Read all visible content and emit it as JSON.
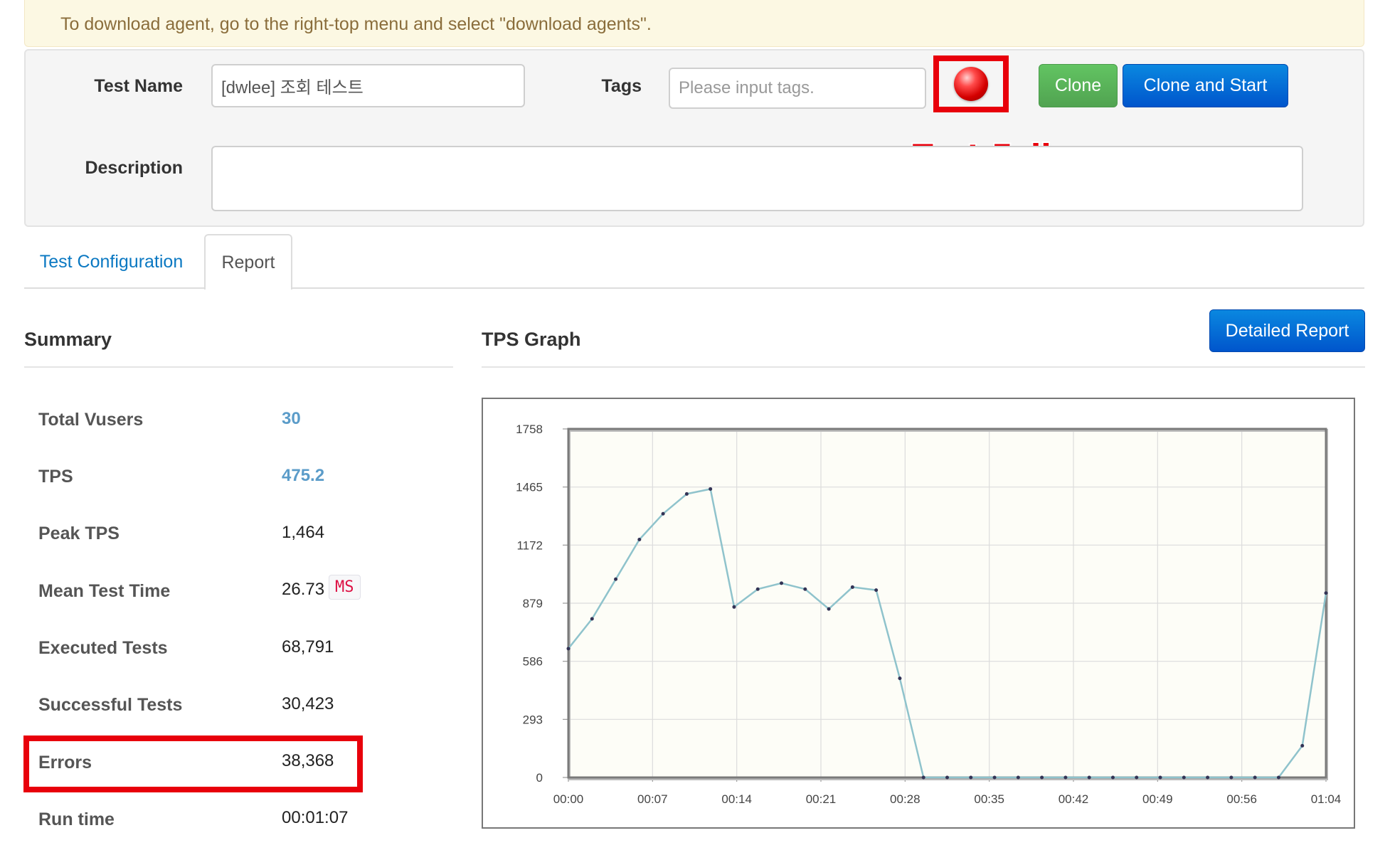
{
  "notice": {
    "text": "To download agent, go to the right-top menu and select \"download agents\"."
  },
  "form": {
    "test_name_label": "Test Name",
    "test_name_value": "[dwlee] 조회 테스트",
    "tags_label": "Tags",
    "tags_placeholder": "Please input tags.",
    "status": "failed",
    "status_annotation": "Test Fail",
    "clone_label": "Clone",
    "clone_start_label": "Clone and Start",
    "description_label": "Description",
    "description_value": ""
  },
  "tabs": [
    {
      "label": "Test Configuration",
      "active": false
    },
    {
      "label": "Report",
      "active": true
    }
  ],
  "summary": {
    "title": "Summary",
    "rows": [
      {
        "label": "Total Vusers",
        "value": "30"
      },
      {
        "label": "TPS",
        "value": "475.2"
      },
      {
        "label": "Peak TPS",
        "value": "1,464"
      },
      {
        "label": "Mean Test Time",
        "value": "26.73",
        "unit": "MS"
      },
      {
        "label": "Executed Tests",
        "value": "68,791"
      },
      {
        "label": "Successful Tests",
        "value": "30,423"
      },
      {
        "label": "Errors",
        "value": "38,368"
      },
      {
        "label": "Run time",
        "value": "00:01:07"
      }
    ]
  },
  "graph": {
    "title": "TPS Graph",
    "detailed_report_label": "Detailed Report"
  },
  "colors": {
    "accent_blue": "#0a78c2",
    "success_green": "#5bb75b",
    "fail_red": "#e8000b",
    "line": "#8fc3cc",
    "plot_bg": "#fdfdf7"
  },
  "chart_data": {
    "type": "line",
    "title": "TPS Graph",
    "xlabel": "",
    "ylabel": "",
    "x_ticks": [
      "00:00",
      "00:07",
      "00:14",
      "00:21",
      "00:28",
      "00:35",
      "00:42",
      "00:49",
      "00:56",
      "01:04"
    ],
    "y_ticks": [
      0,
      293,
      586,
      879,
      1172,
      1465,
      1758
    ],
    "ylim": [
      0,
      1758
    ],
    "xlim": [
      0,
      64
    ],
    "grid": true,
    "series": [
      {
        "x": [
          0,
          2,
          4,
          6,
          8,
          10,
          12,
          14,
          16,
          18,
          20,
          22,
          24,
          26,
          28,
          30,
          32,
          34,
          36,
          38,
          40,
          42,
          44,
          46,
          48,
          50,
          52,
          54,
          56,
          58,
          60,
          62,
          64
        ],
        "y": [
          650,
          800,
          1000,
          1200,
          1330,
          1430,
          1455,
          860,
          950,
          980,
          950,
          850,
          960,
          945,
          500,
          0,
          0,
          0,
          0,
          0,
          0,
          0,
          0,
          0,
          0,
          0,
          0,
          0,
          0,
          0,
          0,
          160,
          930
        ]
      }
    ]
  }
}
